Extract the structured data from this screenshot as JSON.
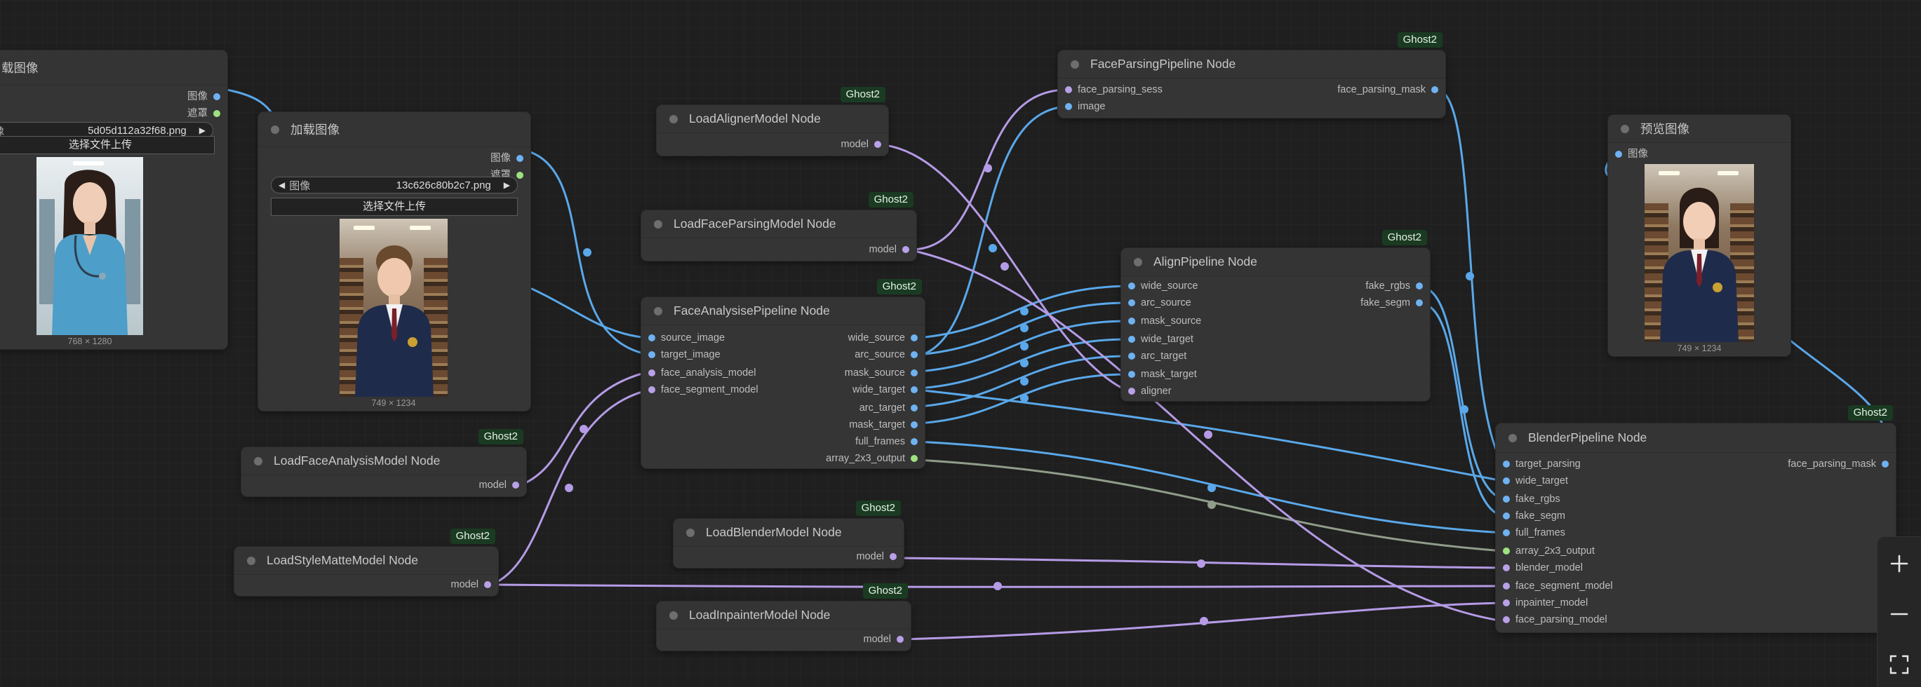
{
  "badge_text": "Ghost2",
  "nodes": {
    "load_image_1": {
      "title": "载图像",
      "outputs": [
        "图像",
        "遮罩"
      ],
      "image_label": "像",
      "image_value": "5d05d112a32f68.png",
      "upload_label": "选择文件上传",
      "dims": "768 × 1280"
    },
    "load_image_2": {
      "title": "加载图像",
      "outputs": [
        "图像",
        "遮罩"
      ],
      "image_label": "图像",
      "image_value": "13c626c80b2c7.png",
      "upload_label": "选择文件上传",
      "dims": "749 × 1234"
    },
    "load_aligner": {
      "title": "LoadAlignerModel Node",
      "outputs": [
        "model"
      ]
    },
    "load_face_parsing": {
      "title": "LoadFaceParsingModel Node",
      "outputs": [
        "model"
      ]
    },
    "face_parsing_pipeline": {
      "title": "FaceParsingPipeline Node",
      "inputs": [
        "face_parsing_sess",
        "image"
      ],
      "outputs": [
        "face_parsing_mask"
      ]
    },
    "face_analysis_pipeline": {
      "title": "FaceAnalysisePipeline Node",
      "inputs": [
        "source_image",
        "target_image",
        "face_analysis_model",
        "face_segment_model"
      ],
      "outputs": [
        "wide_source",
        "arc_source",
        "mask_source",
        "wide_target",
        "arc_target",
        "mask_target",
        "full_frames",
        "array_2x3_output"
      ]
    },
    "align_pipeline": {
      "title": "AlignPipeline Node",
      "inputs": [
        "wide_source",
        "arc_source",
        "mask_source",
        "wide_target",
        "arc_target",
        "mask_target",
        "aligner"
      ],
      "outputs": [
        "fake_rgbs",
        "fake_segm"
      ]
    },
    "load_face_analysis": {
      "title": "LoadFaceAnalysisModel Node",
      "outputs": [
        "model"
      ]
    },
    "load_style_matte": {
      "title": "LoadStyleMatteModel Node",
      "outputs": [
        "model"
      ]
    },
    "load_blender": {
      "title": "LoadBlenderModel Node",
      "outputs": [
        "model"
      ]
    },
    "load_inpainter": {
      "title": "LoadInpainterModel Node",
      "outputs": [
        "model"
      ]
    },
    "preview_image": {
      "title": "预览图像",
      "inputs": [
        "图像"
      ],
      "dims": "749 × 1234"
    },
    "blender_pipeline": {
      "title": "BlenderPipeline Node",
      "inputs": [
        "target_parsing",
        "wide_target",
        "fake_rgbs",
        "fake_segm",
        "full_frames",
        "array_2x3_output",
        "blender_model",
        "face_segment_model",
        "inpainter_model",
        "face_parsing_model"
      ],
      "outputs": [
        "face_parsing_mask"
      ]
    }
  },
  "colors": {
    "image_wire": "#5aa8ea",
    "model_wire": "#b59be6",
    "array_wire": "#8f9d8a",
    "badge_bg": "#1a3b22",
    "canvas_bg": "#1f1f1f",
    "node_bg": "#353535"
  },
  "icons": [
    "plus-icon",
    "minus-icon",
    "fit-view-icon"
  ]
}
